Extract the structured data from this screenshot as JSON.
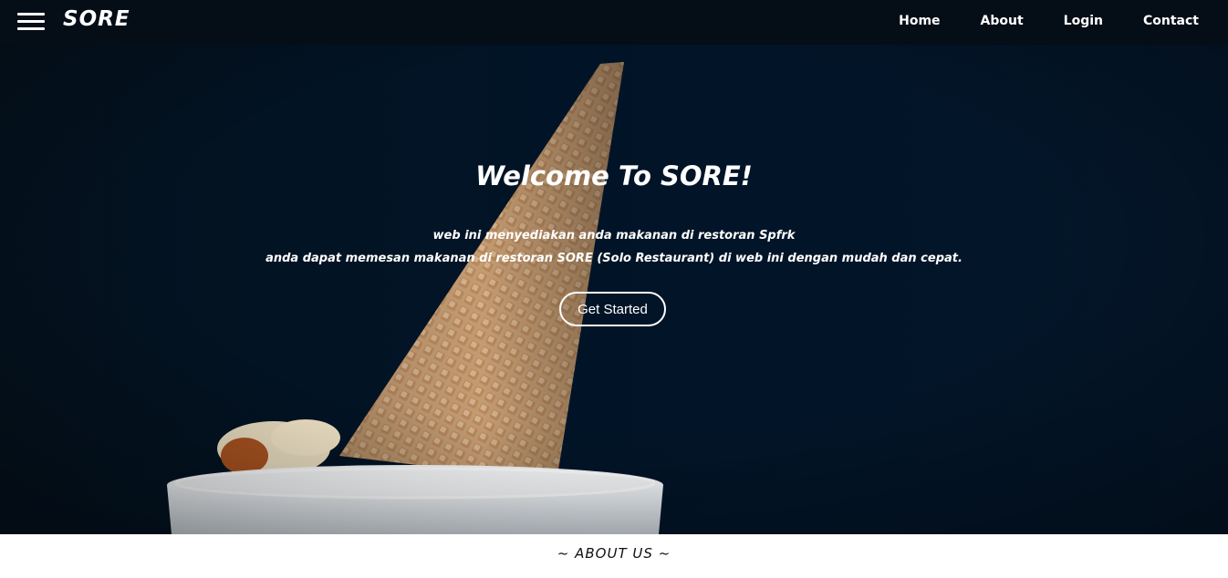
{
  "navbar": {
    "brand": "SORE",
    "links": [
      {
        "label": "Home"
      },
      {
        "label": "About"
      },
      {
        "label": "Login"
      },
      {
        "label": "Contact"
      }
    ]
  },
  "hero": {
    "title": "Welcome To SORE!",
    "line1": "web ini menyediakan anda makanan di restoran Spfrk",
    "line2": "anda dapat memesan makanan di restoran SORE (Solo Restaurant) di web ini dengan mudah dan cepat.",
    "cta_label": "Get Started"
  },
  "about": {
    "heading": "~ ABOUT US ~"
  },
  "icons": {
    "menu": "hamburger-menu-icon"
  },
  "colors": {
    "hero_bg": "#011427",
    "navbar_bg": "#050d16",
    "cone": "#c9a27a",
    "cup": "#e9eef2"
  }
}
